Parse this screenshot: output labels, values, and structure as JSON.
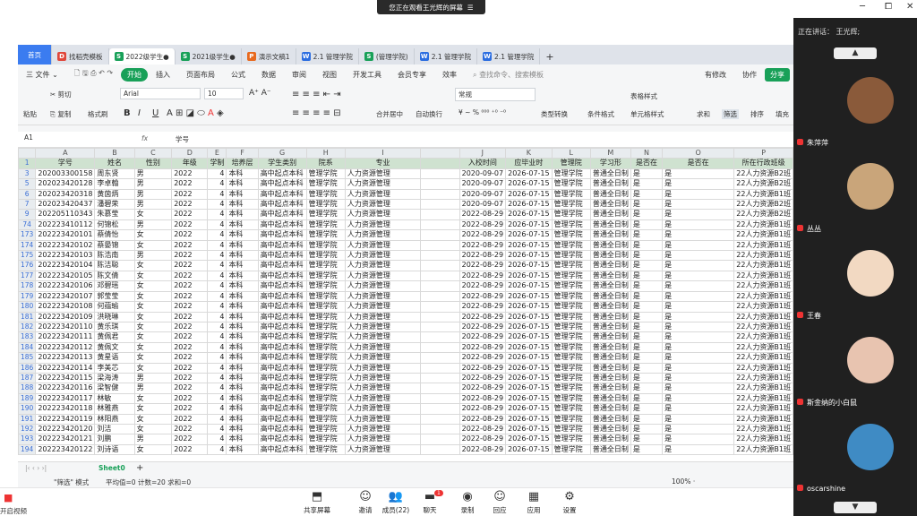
{
  "top": {
    "share_text": "您正在观看王光辉的屏幕",
    "close": "☰",
    "winctl": [
      "─",
      "⧠",
      "✕"
    ]
  },
  "tabs": [
    {
      "label": "首页",
      "icon": "",
      "type": "home"
    },
    {
      "label": "找稻壳模板",
      "icon": "r",
      "glyph": "D"
    },
    {
      "label": "2022级学生●",
      "icon": "s",
      "glyph": "S",
      "active": true
    },
    {
      "label": "2021级学生●",
      "icon": "s",
      "glyph": "S"
    },
    {
      "label": "演示文稿1",
      "icon": "p",
      "glyph": "P"
    },
    {
      "label": "2.1 管理学院",
      "icon": "w",
      "glyph": "W"
    },
    {
      "label": "(管理学院)",
      "icon": "s",
      "glyph": "S"
    },
    {
      "label": "2.1 管理学院",
      "icon": "w",
      "glyph": "W"
    },
    {
      "label": "2.1 管理学院",
      "icon": "w",
      "glyph": "W"
    }
  ],
  "menu": {
    "file": "三 文件 ⌄",
    "items": [
      "开始",
      "插入",
      "页面布局",
      "公式",
      "数据",
      "审阅",
      "视图",
      "开发工具",
      "会员专享",
      "效率"
    ],
    "search": "查找命令、搜索模板",
    "right": [
      "有修改",
      "协作",
      "分享"
    ]
  },
  "ribbon": {
    "cut": "剪切",
    "paste": "粘贴",
    "copy": "复制",
    "format_painter": "格式刷",
    "font": "Arial",
    "size": "10",
    "bold": "B",
    "italic": "I",
    "underline": "U",
    "merge": "合并居中",
    "wrap": "自动换行",
    "number_format": "常规",
    "type_convert": "类型转换",
    "cond_format": "条件格式",
    "table_style": "表格样式",
    "cell_style": "单元格样式",
    "sum": "求和",
    "filter": "筛选",
    "sort": "排序",
    "fill": "填充"
  },
  "formula": {
    "cell_ref": "A1",
    "fx": "fx",
    "value": "学号"
  },
  "columns": [
    "A",
    "B",
    "C",
    "D",
    "E",
    "F",
    "G",
    "H",
    "I",
    "J",
    "K",
    "L",
    "M",
    "N",
    "O",
    "P"
  ],
  "header_row": {
    "rn": "1",
    "cells": [
      "学号",
      "姓名",
      "性别",
      "年级",
      "学制",
      "培养层",
      "学生类别",
      "院系",
      "专业",
      "",
      "入校时间",
      "应毕业时",
      "管理院",
      "学习形",
      "是否在",
      "是否在",
      "所在行政班级"
    ]
  },
  "rows": [
    {
      "rn": "3",
      "cells": [
        "202003300158",
        "周东贤",
        "男",
        "2022",
        "4",
        "本科",
        "高中起点本科",
        "管理学院",
        "人力资源管理",
        "2020-09-07",
        "2026-07-15",
        "管理学院",
        "普通全日制",
        "是",
        "是",
        "22人力资源B2班"
      ]
    },
    {
      "rn": "5",
      "cells": [
        "202023420128",
        "李卓翰",
        "男",
        "2022",
        "4",
        "本科",
        "高中起点本科",
        "管理学院",
        "人力资源管理",
        "2020-09-07",
        "2026-07-15",
        "管理学院",
        "普通全日制",
        "是",
        "是",
        "22人力资源B2班"
      ]
    },
    {
      "rn": "6",
      "cells": [
        "202023420318",
        "黄茵炳",
        "男",
        "2022",
        "4",
        "本科",
        "高中起点本科",
        "管理学院",
        "人力资源管理",
        "2020-09-07",
        "2026-07-15",
        "管理学院",
        "普通全日制",
        "是",
        "是",
        "22人力资源B1班"
      ]
    },
    {
      "rn": "7",
      "cells": [
        "202023420437",
        "潘碧荣",
        "男",
        "2022",
        "4",
        "本科",
        "高中起点本科",
        "管理学院",
        "人力资源管理",
        "2020-09-07",
        "2026-07-15",
        "管理学院",
        "普通全日制",
        "是",
        "是",
        "22人力资源B2班"
      ]
    },
    {
      "rn": "9",
      "cells": [
        "202205110343",
        "朱慕莹",
        "女",
        "2022",
        "4",
        "本科",
        "高中起点本科",
        "管理学院",
        "人力资源管理",
        "2022-08-29",
        "2026-07-15",
        "管理学院",
        "普通全日制",
        "是",
        "是",
        "22人力资源B2班"
      ]
    },
    {
      "rn": "74",
      "cells": [
        "202223410112",
        "何锦松",
        "男",
        "2022",
        "4",
        "本科",
        "高中起点本科",
        "管理学院",
        "人力资源管理",
        "2022-08-29",
        "2026-07-15",
        "管理学院",
        "普通全日制",
        "是",
        "是",
        "22人力资源B1班"
      ]
    },
    {
      "rn": "173",
      "cells": [
        "202223420101",
        "蔡倩怡",
        "女",
        "2022",
        "4",
        "本科",
        "高中起点本科",
        "管理学院",
        "人力资源管理",
        "2022-08-29",
        "2026-07-15",
        "管理学院",
        "普通全日制",
        "是",
        "是",
        "22人力资源B1班"
      ]
    },
    {
      "rn": "174",
      "cells": [
        "202223420102",
        "蔡晏锦",
        "女",
        "2022",
        "4",
        "本科",
        "高中起点本科",
        "管理学院",
        "人力资源管理",
        "2022-08-29",
        "2026-07-15",
        "管理学院",
        "普通全日制",
        "是",
        "是",
        "22人力资源B1班"
      ]
    },
    {
      "rn": "175",
      "cells": [
        "202223420103",
        "陈浩南",
        "男",
        "2022",
        "4",
        "本科",
        "高中起点本科",
        "管理学院",
        "人力资源管理",
        "2022-08-29",
        "2026-07-15",
        "管理学院",
        "普通全日制",
        "是",
        "是",
        "22人力资源B1班"
      ]
    },
    {
      "rn": "176",
      "cells": [
        "202223420104",
        "陈洁聪",
        "女",
        "2022",
        "4",
        "本科",
        "高中起点本科",
        "管理学院",
        "人力资源管理",
        "2022-08-29",
        "2026-07-15",
        "管理学院",
        "普通全日制",
        "是",
        "是",
        "22人力资源B1班"
      ]
    },
    {
      "rn": "177",
      "cells": [
        "202223420105",
        "陈文倩",
        "女",
        "2022",
        "4",
        "本科",
        "高中起点本科",
        "管理学院",
        "人力资源管理",
        "2022-08-29",
        "2026-07-15",
        "管理学院",
        "普通全日制",
        "是",
        "是",
        "22人力资源B1班"
      ]
    },
    {
      "rn": "178",
      "cells": [
        "202223420106",
        "邓碧瑶",
        "女",
        "2022",
        "4",
        "本科",
        "高中起点本科",
        "管理学院",
        "人力资源管理",
        "2022-08-29",
        "2026-07-15",
        "管理学院",
        "普通全日制",
        "是",
        "是",
        "22人力资源B1班"
      ]
    },
    {
      "rn": "179",
      "cells": [
        "202223420107",
        "郭莹莹",
        "女",
        "2022",
        "4",
        "本科",
        "高中起点本科",
        "管理学院",
        "人力资源管理",
        "2022-08-29",
        "2026-07-15",
        "管理学院",
        "普通全日制",
        "是",
        "是",
        "22人力资源B1班"
      ]
    },
    {
      "rn": "180",
      "cells": [
        "202223420108",
        "何蕴瑜",
        "女",
        "2022",
        "4",
        "本科",
        "高中起点本科",
        "管理学院",
        "人力资源管理",
        "2022-08-29",
        "2026-07-15",
        "管理学院",
        "普通全日制",
        "是",
        "是",
        "22人力资源B1班"
      ]
    },
    {
      "rn": "181",
      "cells": [
        "202223420109",
        "洪晓琳",
        "女",
        "2022",
        "4",
        "本科",
        "高中起点本科",
        "管理学院",
        "人力资源管理",
        "2022-08-29",
        "2026-07-15",
        "管理学院",
        "普通全日制",
        "是",
        "是",
        "22人力资源B1班"
      ]
    },
    {
      "rn": "182",
      "cells": [
        "202223420110",
        "黄乐琪",
        "女",
        "2022",
        "4",
        "本科",
        "高中起点本科",
        "管理学院",
        "人力资源管理",
        "2022-08-29",
        "2026-07-15",
        "管理学院",
        "普通全日制",
        "是",
        "是",
        "22人力资源B1班"
      ]
    },
    {
      "rn": "183",
      "cells": [
        "202223420111",
        "黄佩君",
        "女",
        "2022",
        "4",
        "本科",
        "高中起点本科",
        "管理学院",
        "人力资源管理",
        "2022-08-29",
        "2026-07-15",
        "管理学院",
        "普通全日制",
        "是",
        "是",
        "22人力资源B1班"
      ]
    },
    {
      "rn": "184",
      "cells": [
        "202223420112",
        "黄佩文",
        "女",
        "2022",
        "4",
        "本科",
        "高中起点本科",
        "管理学院",
        "人力资源管理",
        "2022-08-29",
        "2026-07-15",
        "管理学院",
        "普通全日制",
        "是",
        "是",
        "22人力资源B1班"
      ]
    },
    {
      "rn": "185",
      "cells": [
        "202223420113",
        "黄星语",
        "女",
        "2022",
        "4",
        "本科",
        "高中起点本科",
        "管理学院",
        "人力资源管理",
        "2022-08-29",
        "2026-07-15",
        "管理学院",
        "普通全日制",
        "是",
        "是",
        "22人力资源B1班"
      ]
    },
    {
      "rn": "186",
      "cells": [
        "202223420114",
        "李美芯",
        "女",
        "2022",
        "4",
        "本科",
        "高中起点本科",
        "管理学院",
        "人力资源管理",
        "2022-08-29",
        "2026-07-15",
        "管理学院",
        "普通全日制",
        "是",
        "是",
        "22人力资源B1班"
      ]
    },
    {
      "rn": "187",
      "cells": [
        "202223420115",
        "梁海涛",
        "男",
        "2022",
        "4",
        "本科",
        "高中起点本科",
        "管理学院",
        "人力资源管理",
        "2022-08-29",
        "2026-07-15",
        "管理学院",
        "普通全日制",
        "是",
        "是",
        "22人力资源B1班"
      ]
    },
    {
      "rn": "188",
      "cells": [
        "202223420116",
        "梁智健",
        "男",
        "2022",
        "4",
        "本科",
        "高中起点本科",
        "管理学院",
        "人力资源管理",
        "2022-08-29",
        "2026-07-15",
        "管理学院",
        "普通全日制",
        "是",
        "是",
        "22人力资源B1班"
      ]
    },
    {
      "rn": "189",
      "cells": [
        "202223420117",
        "林敏",
        "女",
        "2022",
        "4",
        "本科",
        "高中起点本科",
        "管理学院",
        "人力资源管理",
        "2022-08-29",
        "2026-07-15",
        "管理学院",
        "普通全日制",
        "是",
        "是",
        "22人力资源B1班"
      ]
    },
    {
      "rn": "190",
      "cells": [
        "202223420118",
        "林雅燕",
        "女",
        "2022",
        "4",
        "本科",
        "高中起点本科",
        "管理学院",
        "人力资源管理",
        "2022-08-29",
        "2026-07-15",
        "管理学院",
        "普通全日制",
        "是",
        "是",
        "22人力资源B1班"
      ]
    },
    {
      "rn": "191",
      "cells": [
        "202223420119",
        "林阳燕",
        "女",
        "2022",
        "4",
        "本科",
        "高中起点本科",
        "管理学院",
        "人力资源管理",
        "2022-08-29",
        "2026-07-15",
        "管理学院",
        "普通全日制",
        "是",
        "是",
        "22人力资源B1班"
      ]
    },
    {
      "rn": "192",
      "cells": [
        "202223420120",
        "刘洁",
        "女",
        "2022",
        "4",
        "本科",
        "高中起点本科",
        "管理学院",
        "人力资源管理",
        "2022-08-29",
        "2026-07-15",
        "管理学院",
        "普通全日制",
        "是",
        "是",
        "22人力资源B1班"
      ]
    },
    {
      "rn": "193",
      "cells": [
        "202223420121",
        "刘鹏",
        "男",
        "2022",
        "4",
        "本科",
        "高中起点本科",
        "管理学院",
        "人力资源管理",
        "2022-08-29",
        "2026-07-15",
        "管理学院",
        "普通全日制",
        "是",
        "是",
        "22人力资源B1班"
      ]
    },
    {
      "rn": "194",
      "cells": [
        "202223420122",
        "刘诗语",
        "女",
        "2022",
        "4",
        "本科",
        "高中起点本科",
        "管理学院",
        "人力资源管理",
        "2022-08-29",
        "2026-07-15",
        "管理学院",
        "普通全日制",
        "是",
        "是",
        "22人力资源B1班"
      ]
    }
  ],
  "sheet": {
    "name": "Sheet0",
    "add": "+"
  },
  "status": {
    "mode": "\"筛选\" 模式",
    "stats": "平均值=0  计数=20  求和=0",
    "zoom": "100% ·"
  },
  "meeting": {
    "left_label": "开启视频",
    "buttons": [
      {
        "label": "共享屏幕",
        "icon": "⬒"
      },
      {
        "label": "邀请",
        "icon": "☺"
      },
      {
        "label": "成员(22)",
        "icon": "👥"
      },
      {
        "label": "聊天",
        "icon": "▬",
        "badge": "1"
      },
      {
        "label": "录制",
        "icon": "◉"
      },
      {
        "label": "回应",
        "icon": "☺"
      },
      {
        "label": "应用",
        "icon": "▦"
      },
      {
        "label": "设置",
        "icon": "⚙"
      }
    ]
  },
  "side": {
    "speaking": "正在讲话： 王光辉;",
    "participants": [
      {
        "name": "朱萍萍",
        "color": "#8a5a3a"
      },
      {
        "name": "丛丛",
        "color": "#c9a57a"
      },
      {
        "name": "王春",
        "color": "#f2d9c2"
      },
      {
        "name": "斯金纳的小白鼠",
        "color": "#e8c4b0"
      },
      {
        "name": "oscarshine",
        "color": "#3f8bc4"
      }
    ]
  }
}
